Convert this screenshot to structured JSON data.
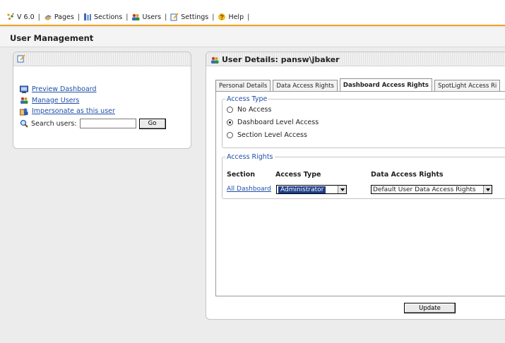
{
  "topbar": {
    "version": "V 6.0",
    "separator": "|",
    "pages": "Pages",
    "sections": "Sections",
    "users": "Users",
    "settings": "Settings",
    "help": "Help"
  },
  "page_title": "User Management",
  "left_panel": {
    "links": {
      "preview": "Preview Dashboard",
      "manage": "Manage Users",
      "impersonate": "Impersonate as this user"
    },
    "search_label": "Search users:",
    "search_value": "",
    "go_label": "Go"
  },
  "user_details": {
    "title": "User Details: pansw\\jbaker",
    "tabs": [
      "Personal Details",
      "Data Access Rights",
      "Dashboard Access Rights",
      "SpotLight Access Ri"
    ],
    "active_tab": "Dashboard Access Rights",
    "access_type": {
      "legend": "Access Type",
      "options": [
        "No Access",
        "Dashboard Level Access",
        "Section Level Access"
      ],
      "selected": "Dashboard Level Access"
    },
    "access_rights": {
      "legend": "Access Rights",
      "headers": [
        "Section",
        "Access Type",
        "Data Access Rights"
      ],
      "row": {
        "section": "All Dashboard",
        "access_type": "Administrator",
        "data_rights": "Default User Data Access Rights"
      }
    },
    "update_label": "Update"
  },
  "colors": {
    "accent_bar": "#f0a020",
    "link": "#1f4fa8",
    "selected_option": "#1d3c88"
  }
}
